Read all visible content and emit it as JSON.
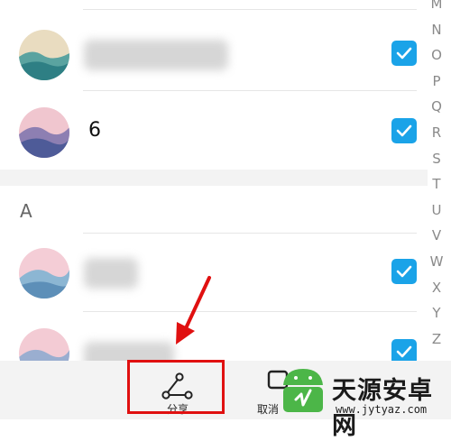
{
  "contacts": [
    {
      "name": "",
      "checked": true
    },
    {
      "name": "6",
      "checked": true
    },
    {
      "name": "",
      "checked": true
    },
    {
      "name": "",
      "checked": true
    }
  ],
  "section_letter": "A",
  "index_letters": [
    "M",
    "N",
    "O",
    "P",
    "Q",
    "R",
    "S",
    "T",
    "U",
    "V",
    "W",
    "X",
    "Y",
    "Z"
  ],
  "bottom_bar": {
    "share_label": "分享",
    "cancel_label": "取消"
  },
  "watermark": {
    "text": "天源安卓网",
    "url": "www.jytyaz.com"
  },
  "colors": {
    "checkbox": "#1aa3e8",
    "highlight": "#e01010",
    "watermark_green": "#4cb648"
  }
}
